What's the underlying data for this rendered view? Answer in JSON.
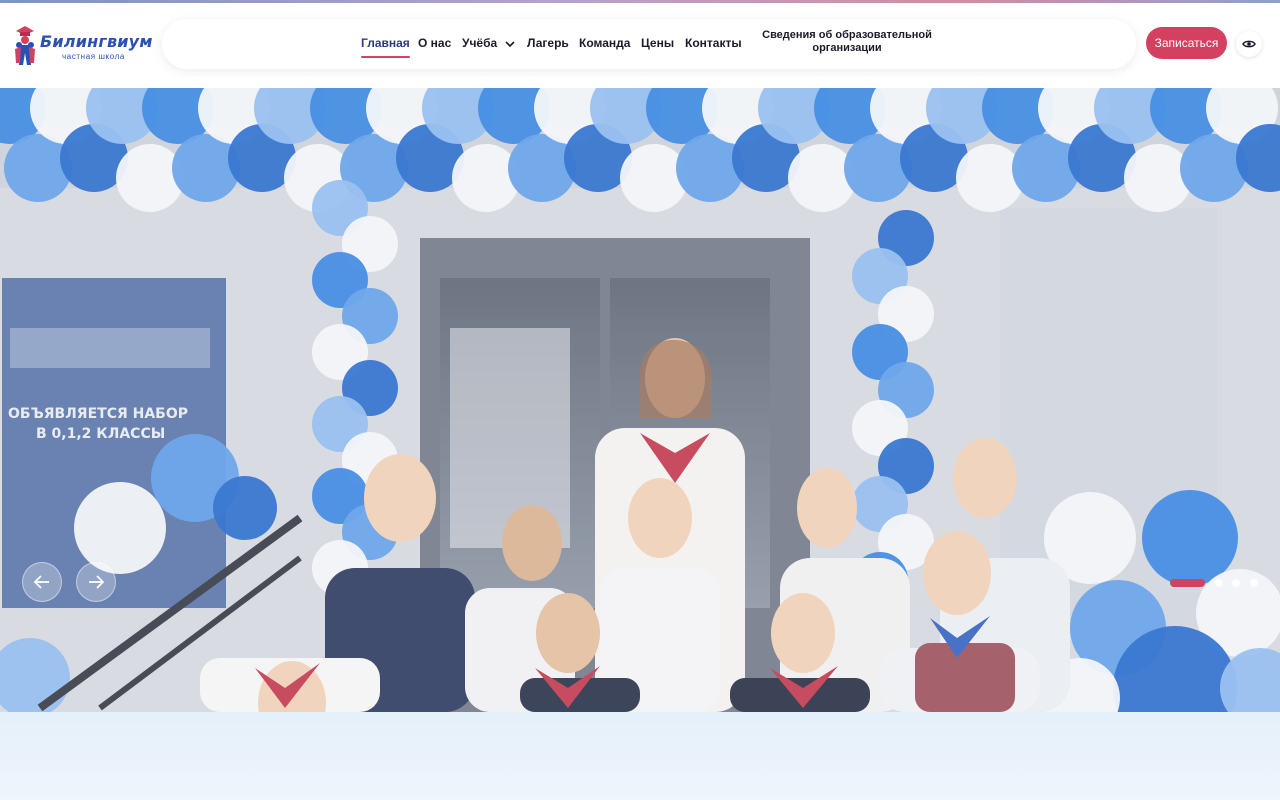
{
  "header": {
    "logo": {
      "name": "Билингвиум",
      "tagline": "частная школа"
    },
    "nav": [
      {
        "label": "Главная",
        "active": true
      },
      {
        "label": "О нас"
      },
      {
        "label": "Учёба",
        "has_dropdown": true
      },
      {
        "label": "Лагерь"
      },
      {
        "label": "Команда"
      },
      {
        "label": "Цены"
      },
      {
        "label": "Контакты"
      }
    ],
    "info_link": {
      "line1": "Сведения об образовательной",
      "line2": "организации"
    },
    "signup_label": "Записаться",
    "accessibility_icon": "eye-icon"
  },
  "hero": {
    "banner_line1": "ОБЪЯВЛЯЕТСЯ НАБОР",
    "banner_line2": "В 0,1,2 КЛАССЫ",
    "prev_icon": "arrow-left-icon",
    "next_icon": "arrow-right-icon",
    "slides_total": 4,
    "active_slide": 1
  },
  "colors": {
    "accent": "#d4405f",
    "brand_blue": "#2b4fb3",
    "nav_text": "#1b1b2a",
    "balloon_blue": "#2f7fe0",
    "balloon_white": "#f2f4f8"
  }
}
